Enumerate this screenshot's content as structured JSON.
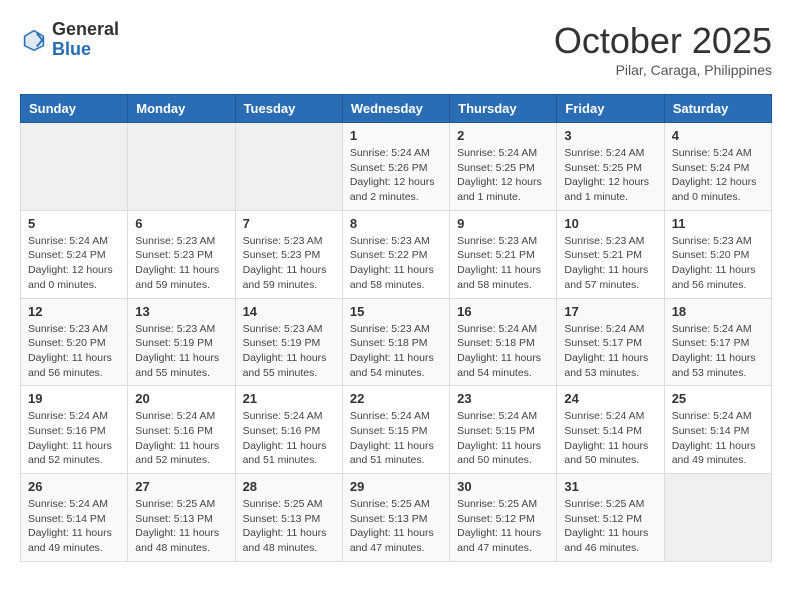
{
  "header": {
    "logo_general": "General",
    "logo_blue": "Blue",
    "month": "October 2025",
    "location": "Pilar, Caraga, Philippines"
  },
  "weekdays": [
    "Sunday",
    "Monday",
    "Tuesday",
    "Wednesday",
    "Thursday",
    "Friday",
    "Saturday"
  ],
  "weeks": [
    [
      {
        "day": "",
        "info": ""
      },
      {
        "day": "",
        "info": ""
      },
      {
        "day": "",
        "info": ""
      },
      {
        "day": "1",
        "info": "Sunrise: 5:24 AM\nSunset: 5:26 PM\nDaylight: 12 hours and 2 minutes."
      },
      {
        "day": "2",
        "info": "Sunrise: 5:24 AM\nSunset: 5:25 PM\nDaylight: 12 hours and 1 minute."
      },
      {
        "day": "3",
        "info": "Sunrise: 5:24 AM\nSunset: 5:25 PM\nDaylight: 12 hours and 1 minute."
      },
      {
        "day": "4",
        "info": "Sunrise: 5:24 AM\nSunset: 5:24 PM\nDaylight: 12 hours and 0 minutes."
      }
    ],
    [
      {
        "day": "5",
        "info": "Sunrise: 5:24 AM\nSunset: 5:24 PM\nDaylight: 12 hours and 0 minutes."
      },
      {
        "day": "6",
        "info": "Sunrise: 5:23 AM\nSunset: 5:23 PM\nDaylight: 11 hours and 59 minutes."
      },
      {
        "day": "7",
        "info": "Sunrise: 5:23 AM\nSunset: 5:23 PM\nDaylight: 11 hours and 59 minutes."
      },
      {
        "day": "8",
        "info": "Sunrise: 5:23 AM\nSunset: 5:22 PM\nDaylight: 11 hours and 58 minutes."
      },
      {
        "day": "9",
        "info": "Sunrise: 5:23 AM\nSunset: 5:21 PM\nDaylight: 11 hours and 58 minutes."
      },
      {
        "day": "10",
        "info": "Sunrise: 5:23 AM\nSunset: 5:21 PM\nDaylight: 11 hours and 57 minutes."
      },
      {
        "day": "11",
        "info": "Sunrise: 5:23 AM\nSunset: 5:20 PM\nDaylight: 11 hours and 56 minutes."
      }
    ],
    [
      {
        "day": "12",
        "info": "Sunrise: 5:23 AM\nSunset: 5:20 PM\nDaylight: 11 hours and 56 minutes."
      },
      {
        "day": "13",
        "info": "Sunrise: 5:23 AM\nSunset: 5:19 PM\nDaylight: 11 hours and 55 minutes."
      },
      {
        "day": "14",
        "info": "Sunrise: 5:23 AM\nSunset: 5:19 PM\nDaylight: 11 hours and 55 minutes."
      },
      {
        "day": "15",
        "info": "Sunrise: 5:23 AM\nSunset: 5:18 PM\nDaylight: 11 hours and 54 minutes."
      },
      {
        "day": "16",
        "info": "Sunrise: 5:24 AM\nSunset: 5:18 PM\nDaylight: 11 hours and 54 minutes."
      },
      {
        "day": "17",
        "info": "Sunrise: 5:24 AM\nSunset: 5:17 PM\nDaylight: 11 hours and 53 minutes."
      },
      {
        "day": "18",
        "info": "Sunrise: 5:24 AM\nSunset: 5:17 PM\nDaylight: 11 hours and 53 minutes."
      }
    ],
    [
      {
        "day": "19",
        "info": "Sunrise: 5:24 AM\nSunset: 5:16 PM\nDaylight: 11 hours and 52 minutes."
      },
      {
        "day": "20",
        "info": "Sunrise: 5:24 AM\nSunset: 5:16 PM\nDaylight: 11 hours and 52 minutes."
      },
      {
        "day": "21",
        "info": "Sunrise: 5:24 AM\nSunset: 5:16 PM\nDaylight: 11 hours and 51 minutes."
      },
      {
        "day": "22",
        "info": "Sunrise: 5:24 AM\nSunset: 5:15 PM\nDaylight: 11 hours and 51 minutes."
      },
      {
        "day": "23",
        "info": "Sunrise: 5:24 AM\nSunset: 5:15 PM\nDaylight: 11 hours and 50 minutes."
      },
      {
        "day": "24",
        "info": "Sunrise: 5:24 AM\nSunset: 5:14 PM\nDaylight: 11 hours and 50 minutes."
      },
      {
        "day": "25",
        "info": "Sunrise: 5:24 AM\nSunset: 5:14 PM\nDaylight: 11 hours and 49 minutes."
      }
    ],
    [
      {
        "day": "26",
        "info": "Sunrise: 5:24 AM\nSunset: 5:14 PM\nDaylight: 11 hours and 49 minutes."
      },
      {
        "day": "27",
        "info": "Sunrise: 5:25 AM\nSunset: 5:13 PM\nDaylight: 11 hours and 48 minutes."
      },
      {
        "day": "28",
        "info": "Sunrise: 5:25 AM\nSunset: 5:13 PM\nDaylight: 11 hours and 48 minutes."
      },
      {
        "day": "29",
        "info": "Sunrise: 5:25 AM\nSunset: 5:13 PM\nDaylight: 11 hours and 47 minutes."
      },
      {
        "day": "30",
        "info": "Sunrise: 5:25 AM\nSunset: 5:12 PM\nDaylight: 11 hours and 47 minutes."
      },
      {
        "day": "31",
        "info": "Sunrise: 5:25 AM\nSunset: 5:12 PM\nDaylight: 11 hours and 46 minutes."
      },
      {
        "day": "",
        "info": ""
      }
    ]
  ]
}
